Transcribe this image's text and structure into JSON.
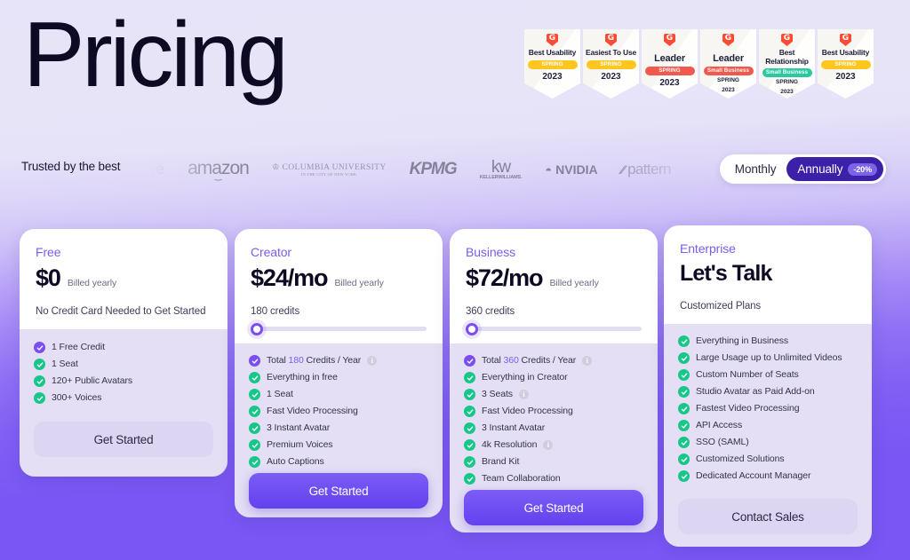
{
  "hero": {
    "title": "Pricing"
  },
  "badges": [
    {
      "name": "g2-badge-best-usability",
      "g2": "G",
      "title": "Best Usability",
      "title_size": "small",
      "ribbon": "SPRING",
      "ribbon_color": "#ffc620",
      "ribbon_style": "yellow",
      "year": "2023",
      "sub": ""
    },
    {
      "name": "g2-badge-easiest-to-use",
      "g2": "G",
      "title": "Easiest To Use",
      "title_size": "small",
      "ribbon": "SPRING",
      "ribbon_color": "#ffc620",
      "ribbon_style": "yellow",
      "year": "2023",
      "sub": ""
    },
    {
      "name": "g2-badge-leader",
      "g2": "G",
      "title": "Leader",
      "title_size": "big",
      "ribbon": "SPRING",
      "ribbon_color": "#f2584c",
      "ribbon_style": "red",
      "year": "2023",
      "sub": ""
    },
    {
      "name": "g2-badge-leader-small-business",
      "g2": "G",
      "title": "Leader",
      "title_size": "big",
      "ribbon": "Small Business",
      "ribbon_color": "#f2584c",
      "ribbon_style": "red",
      "year": "2023",
      "sub": "SPRING"
    },
    {
      "name": "g2-badge-best-relationship",
      "g2": "G",
      "title": "Best Relationship",
      "title_size": "small",
      "ribbon": "Small Business",
      "ribbon_color": "#2bc9a0",
      "ribbon_style": "green",
      "year": "2023",
      "sub": "SPRING"
    },
    {
      "name": "g2-badge-best-usability-2",
      "g2": "G",
      "title": "Best Usability",
      "title_size": "small",
      "ribbon": "SPRING",
      "ribbon_color": "#ffc620",
      "ribbon_style": "yellow",
      "year": "2023",
      "sub": ""
    }
  ],
  "trusted": {
    "label": "Trusted by the best",
    "logos": [
      {
        "name": "logo-partial",
        "text": "re",
        "kind": "fade"
      },
      {
        "name": "logo-amazon",
        "text": "amazon",
        "kind": "amazon"
      },
      {
        "name": "logo-columbia-university",
        "text": "COLUMBIA UNIVERSITY",
        "sub": "IN THE CITY OF NEW YORK",
        "kind": "columbia"
      },
      {
        "name": "logo-kpmg",
        "text": "KPMG",
        "kind": "kpmg"
      },
      {
        "name": "logo-keller-williams",
        "text": "kw",
        "sub": "KELLERWILLIAMS.",
        "kind": "kw"
      },
      {
        "name": "logo-nvidia",
        "text": "NVIDIA",
        "kind": "nvidia"
      },
      {
        "name": "logo-pattern",
        "text": "pattern",
        "kind": "pattern"
      },
      {
        "name": "logo-cloud",
        "text": "☁",
        "kind": "cloud"
      }
    ]
  },
  "billing_toggle": {
    "monthly_label": "Monthly",
    "annually_label": "Annually",
    "discount_badge": "-20%",
    "selected": "Annually"
  },
  "colors": {
    "accent_purple": "#7b4ef2",
    "deep_purple": "#3c21a8",
    "check_green": "#17c78a",
    "page_gradient_top": "#e7e3f8",
    "page_gradient_bottom": "#7857f4"
  },
  "plans": [
    {
      "id": "free",
      "name": "Free",
      "price": "$0",
      "billed": "Billed yearly",
      "note": "No Credit Card Needed to Get Started",
      "credits_label": null,
      "has_slider": false,
      "features": [
        {
          "text": "1 Free Credit",
          "check": "purple",
          "info": false
        },
        {
          "text": "1 Seat",
          "check": "green",
          "info": false
        },
        {
          "text": "120+ Public Avatars",
          "check": "green",
          "info": false
        },
        {
          "text": "300+ Voices",
          "check": "green",
          "info": false
        }
      ],
      "cta": {
        "label": "Get Started",
        "style": "ghost"
      }
    },
    {
      "id": "creator",
      "name": "Creator",
      "price": "$24/mo",
      "billed": "Billed yearly",
      "note": null,
      "credits_label": "180 credits",
      "has_slider": true,
      "features": [
        {
          "text": "Total 180 Credits / Year",
          "highlight": "180",
          "check": "purple",
          "info": true
        },
        {
          "text": "Everything in free",
          "check": "green",
          "info": false
        },
        {
          "text": "1 Seat",
          "check": "green",
          "info": false
        },
        {
          "text": "Fast Video Processing",
          "check": "green",
          "info": false
        },
        {
          "text": "3 Instant Avatar",
          "check": "green",
          "info": false
        },
        {
          "text": "Premium Voices",
          "check": "green",
          "info": false
        },
        {
          "text": "Auto Captions",
          "check": "green",
          "info": false
        }
      ],
      "cta": {
        "label": "Get Started",
        "style": "solid"
      }
    },
    {
      "id": "business",
      "name": "Business",
      "price": "$72/mo",
      "billed": "Billed yearly",
      "note": null,
      "credits_label": "360 credits",
      "has_slider": true,
      "features": [
        {
          "text": "Total 360 Credits / Year",
          "highlight": "360",
          "check": "purple",
          "info": true
        },
        {
          "text": "Everything in Creator",
          "check": "green",
          "info": false
        },
        {
          "text": "3 Seats",
          "check": "green",
          "info": true
        },
        {
          "text": "Fast Video Processing",
          "check": "green",
          "info": false
        },
        {
          "text": "3 Instant Avatar",
          "check": "green",
          "info": false
        },
        {
          "text": "4k Resolution",
          "check": "green",
          "info": true
        },
        {
          "text": "Brand Kit",
          "check": "green",
          "info": false
        },
        {
          "text": "Team Collaboration",
          "check": "green",
          "info": false
        }
      ],
      "cta": {
        "label": "Get Started",
        "style": "solid"
      }
    },
    {
      "id": "enterprise",
      "name": "Enterprise",
      "price": "Let's Talk",
      "billed": null,
      "note": "Customized Plans",
      "credits_label": null,
      "has_slider": false,
      "features": [
        {
          "text": "Everything in Business",
          "check": "green",
          "info": false
        },
        {
          "text": "Large Usage up to Unlimited Videos",
          "check": "green",
          "info": false
        },
        {
          "text": "Custom Number of Seats",
          "check": "green",
          "info": false
        },
        {
          "text": "Studio Avatar as Paid Add-on",
          "check": "green",
          "info": false
        },
        {
          "text": "Fastest Video Processing",
          "check": "green",
          "info": false
        },
        {
          "text": "API Access",
          "check": "green",
          "info": false
        },
        {
          "text": "SSO (SAML)",
          "check": "green",
          "info": false
        },
        {
          "text": "Customized Solutions",
          "check": "green",
          "info": false
        },
        {
          "text": "Dedicated Account Manager",
          "check": "green",
          "info": false
        }
      ],
      "cta": {
        "label": "Contact Sales",
        "style": "ghost"
      }
    }
  ]
}
